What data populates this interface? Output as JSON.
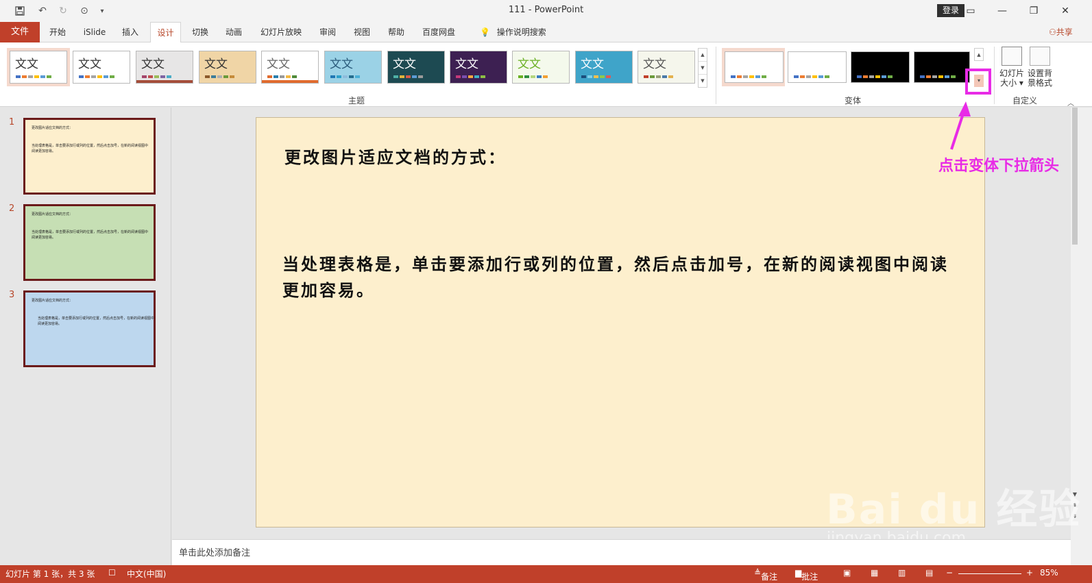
{
  "window": {
    "title": "111  -  PowerPoint",
    "login": "登录",
    "controls": [
      "ribbon-display-icon",
      "minimize-icon",
      "restore-icon",
      "close-icon"
    ]
  },
  "quick_access": [
    "save-icon",
    "undo-icon",
    "redo-icon",
    "present-icon",
    "customize-icon"
  ],
  "tabs": {
    "file": "文件",
    "items": [
      "开始",
      "iSlide",
      "插入",
      "设计",
      "切换",
      "动画",
      "幻灯片放映",
      "审阅",
      "视图",
      "帮助",
      "百度网盘"
    ],
    "active": "设计",
    "tell_me": "操作说明搜索",
    "share": "共享"
  },
  "ribbon": {
    "themes_label": "主题",
    "theme_text": "文文",
    "variants_label": "变体",
    "customize_label": "自定义",
    "slide_size": "幻灯片大小",
    "format_background": "设置背景格式"
  },
  "slides": [
    {
      "num": "1",
      "title": "更改图片适应文档的方式：",
      "body": "当处理表格是，单击要添加行或列的位置，然后点击加号，在新的阅读视图中阅读更加容易。",
      "bg": "#fdefcd"
    },
    {
      "num": "2",
      "title": "更改图片适应文档的方式：",
      "body": "当处理表格是，单击要添加行或列的位置，然后点击加号，在新的阅读视图中阅读更加容易。",
      "bg": "#c6dfb4"
    },
    {
      "num": "3",
      "title": "更改图片适应文档的方式：",
      "body": "当处理表格是，单击要添加行或列的位置，然后点击加号，在新的阅读视图中阅读更加容易。",
      "bg": "#bdd7ee"
    }
  ],
  "main_slide": {
    "title": "更改图片适应文档的方式：",
    "body": "当处理表格是，单击要添加行或列的位置，然后点击加号，在新的阅读视图中阅读更加容易。"
  },
  "annotation": "点击变体下拉箭头",
  "notes_placeholder": "单击此处添加备注",
  "status": {
    "slide_info": "幻灯片 第 1 张，共 3 张",
    "language": "中文(中国)",
    "notes": "备注",
    "comments": "批注",
    "zoom": "85%"
  },
  "watermark": {
    "brand": "Bai du 经验",
    "url": "jingyan.baidu.com"
  }
}
